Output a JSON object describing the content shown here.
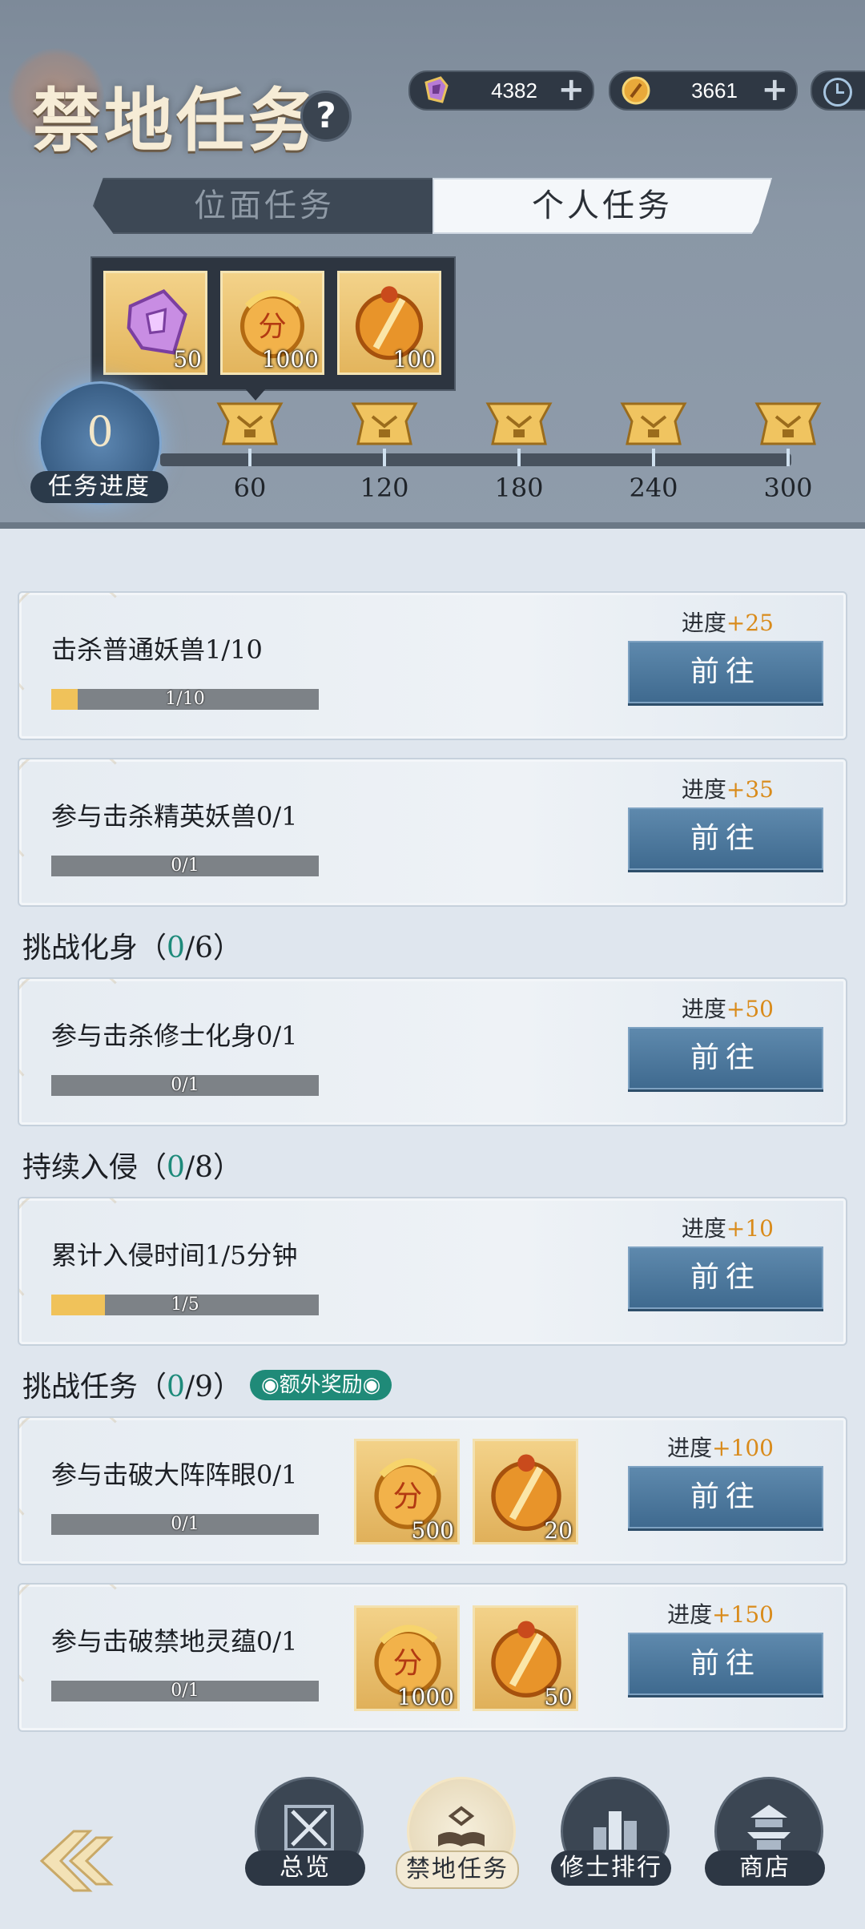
{
  "header": {
    "title": "禁地任务",
    "help_label": "?",
    "currency": [
      {
        "icon": "purple-gem-icon",
        "value": "4382",
        "plus": "+"
      },
      {
        "icon": "gold-coin-icon",
        "value": "3661",
        "plus": "+"
      }
    ],
    "clock_icon": "clock-icon"
  },
  "tabs": [
    {
      "label": "位面任务",
      "active": false
    },
    {
      "label": "个人任务",
      "active": true
    }
  ],
  "reward_popup": {
    "items": [
      {
        "icon": "purple-crystal-icon",
        "qty": "50"
      },
      {
        "icon": "dragon-coin-icon",
        "qty": "1000"
      },
      {
        "icon": "sword-coin-icon",
        "qty": "100"
      }
    ]
  },
  "progress": {
    "value": "0",
    "label": "任务进度",
    "milestones": [
      "60",
      "120",
      "180",
      "240",
      "300"
    ]
  },
  "tasks": [
    {
      "title": "击杀普通妖兽1/10",
      "bar_text": "1/10",
      "fraction": 0.1,
      "gain_label": "进度",
      "gain_value": "+25",
      "button": "前往"
    },
    {
      "title": "参与击杀精英妖兽0/1",
      "bar_text": "0/1",
      "fraction": 0,
      "gain_label": "进度",
      "gain_value": "+35",
      "button": "前往"
    },
    {
      "title": "参与击杀修士化身0/1",
      "bar_text": "0/1",
      "fraction": 0,
      "gain_label": "进度",
      "gain_value": "+50",
      "button": "前往"
    },
    {
      "title": "累计入侵时间1/5分钟",
      "bar_text": "1/5",
      "fraction": 0.2,
      "gain_label": "进度",
      "gain_value": "+10",
      "button": "前往"
    },
    {
      "title": "参与击破大阵阵眼0/1",
      "bar_text": "0/1",
      "fraction": 0,
      "gain_label": "进度",
      "gain_value": "+100",
      "button": "前往",
      "rewards": [
        {
          "icon": "dragon-coin-icon",
          "qty": "500"
        },
        {
          "icon": "sword-coin-icon",
          "qty": "20"
        }
      ]
    },
    {
      "title": "参与击破禁地灵蕴0/1",
      "bar_text": "0/1",
      "fraction": 0,
      "gain_label": "进度",
      "gain_value": "+150",
      "button": "前往",
      "rewards": [
        {
          "icon": "dragon-coin-icon",
          "qty": "1000"
        },
        {
          "icon": "sword-coin-icon",
          "qty": "50"
        }
      ]
    }
  ],
  "sections": [
    {
      "name": "挑战化身",
      "open": "（",
      "done": "0",
      "total": "/6",
      "close": "）"
    },
    {
      "name": "持续入侵",
      "open": "（",
      "done": "0",
      "total": "/8",
      "close": "）"
    },
    {
      "name": "挑战任务",
      "open": "（",
      "done": "0",
      "total": "/9",
      "close": "）"
    }
  ],
  "bonus_badge": "◉额外奖励◉",
  "nav": [
    {
      "label": "总览",
      "icon": "crossed-swords-icon",
      "active": false
    },
    {
      "label": "禁地任务",
      "icon": "book-icon",
      "active": true
    },
    {
      "label": "修士排行",
      "icon": "ranking-icon",
      "active": false
    },
    {
      "label": "商店",
      "icon": "pagoda-icon",
      "active": false
    }
  ],
  "back_icon": "back-arrow-icon",
  "colors": {
    "accent_gold": "#d98b1b",
    "teal": "#1d8a7a",
    "button_blue": "#4f7ba0"
  }
}
